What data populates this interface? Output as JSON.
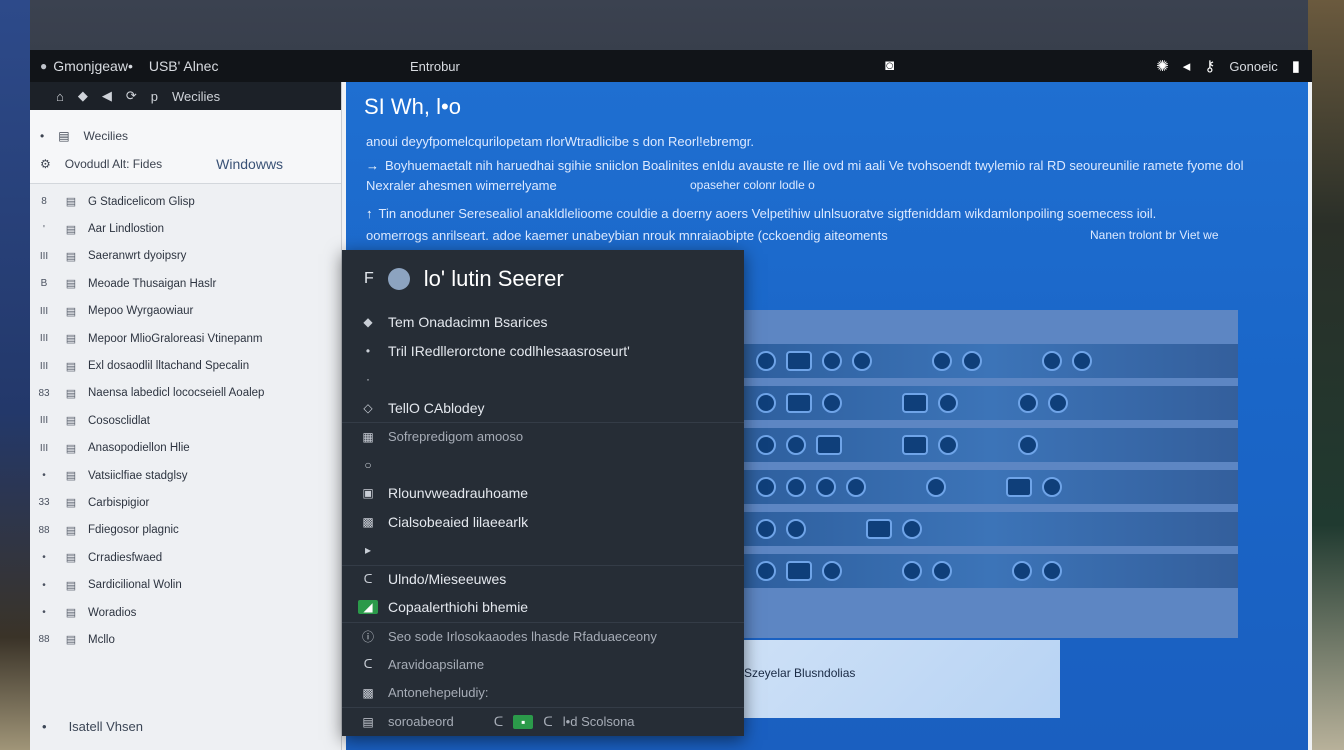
{
  "topbar": {
    "app_name": "Gmonjgeaw•",
    "usb": "USB' Alnec",
    "center_label": "Entrobur",
    "right_label": "Gonoeic",
    "icons": [
      "menu-icon",
      "camera-icon",
      "brightness-icon",
      "volume-icon",
      "key-icon",
      "battery-icon"
    ]
  },
  "sidebar": {
    "toolbar_label": "Wecilies",
    "header": {
      "line1": "Wecilies",
      "line2_left": "Ovodudl Alt: Fides",
      "line2_right": "Windowws"
    },
    "items": [
      {
        "bullet": "8",
        "label": "G Stadicelicom Glisp"
      },
      {
        "bullet": "'",
        "label": "Aar Lindlostion"
      },
      {
        "bullet": "III",
        "label": "Saeranwrt dyoipsry"
      },
      {
        "bullet": "B",
        "label": "Meoade Thusaigan Haslr"
      },
      {
        "bullet": "III",
        "label": "Mepoo Wyrgaowiaur"
      },
      {
        "bullet": "III",
        "label": "Mepoor MlioGraloreasi Vtinepanm"
      },
      {
        "bullet": "III",
        "label": "Exl dosaodlil lltachand Specalin"
      },
      {
        "bullet": "83",
        "label": "Naensa labedicl lococseiell Aoalep"
      },
      {
        "bullet": "III",
        "label": "Cososclidlat"
      },
      {
        "bullet": "III",
        "label": "Anasopodiellon Hlie"
      },
      {
        "bullet": "•",
        "label": "Vatsiiclfiae stadglsy"
      },
      {
        "bullet": "33",
        "label": "Carbispigior"
      },
      {
        "bullet": "88",
        "label": "Fdiegosor plagnic"
      },
      {
        "bullet": "•",
        "label": "Crradiesfwaed"
      },
      {
        "bullet": "•",
        "label": "Sardicilional Wolin"
      },
      {
        "bullet": "•",
        "label": "Woradios"
      },
      {
        "bullet": "88",
        "label": "Mcllo"
      }
    ],
    "footer_left": "•",
    "footer_label": "Isatell Vhsen"
  },
  "main": {
    "title": "SI Wh, l•o",
    "line1": "anoui deyyfpomelcqurilopetam rlorWtradlicibe s don Reorl!ebremgr.",
    "line2": "Boyhuemaetalt nih haruedhai sgihie sniiclon Boalinites enIdu avauste re Ilie ovd mi aali Ve tvohsoendt twylemio ral RD seoureunilie ramete fyome dol",
    "line3": "Nexraler ahesmen wimerrelyame",
    "line3_right": "opaseher colonr lodle o",
    "line4": "Tin anoduner Seresealiol anakldlelioome couldie a doerny aoers Velpetihiw ulnlsuoratve sigtfeniddam wikdamlonpoiling soemecess ioil.",
    "line5": "oomerrogs anrilseart. adoe kaemer unabeybian nrouk mnraiaobipte (cckoendig aiteoments",
    "line5_right": "Nanen trolont br Viet we"
  },
  "menu": {
    "title": "lo' lutin Seerer",
    "items": [
      {
        "icon": "diamond-icon",
        "label": "Tem Onadacimn Bsarices"
      },
      {
        "icon": "bullet-icon",
        "label": "Tril IRedllerorctone codlhlesaasroseurt'"
      },
      {
        "icon": "small-icon",
        "label": ""
      },
      {
        "icon": "chevron-icon",
        "label": "TellO CAblodey"
      },
      {
        "icon": "grid-icon",
        "label": "Sofrepredigom amooso"
      },
      {
        "icon": "dot-icon",
        "label": ""
      },
      {
        "icon": "page-icon",
        "label": "Rlounvweadrauhoame"
      },
      {
        "icon": "image-icon",
        "label": "Cialsobeaied lilaeearlk"
      },
      {
        "icon": "arrow-icon",
        "label": ""
      },
      {
        "icon": "back-icon",
        "label": "Ulndo/Mieseeuwes"
      },
      {
        "icon": "green-icon",
        "label": "Copaalerthiohi bhemie"
      },
      {
        "icon": "info-icon",
        "label": "Seo sode Irlosokaaodes lhasde Rfaduaeceony"
      },
      {
        "icon": "back-icon",
        "label": "Aravidoapsilame"
      },
      {
        "icon": "image-icon",
        "label": "Antonehepeludiy:"
      }
    ],
    "footer": {
      "left": "soroabeord",
      "right": "l•d Scolsona"
    }
  },
  "grid_caption": "Szeyelar Blusndolias",
  "colors": {
    "accent": "#1f6fd1",
    "menu_bg": "#262d36",
    "topbar_bg": "#111418",
    "sidebar_bg": "#eef0f3"
  }
}
